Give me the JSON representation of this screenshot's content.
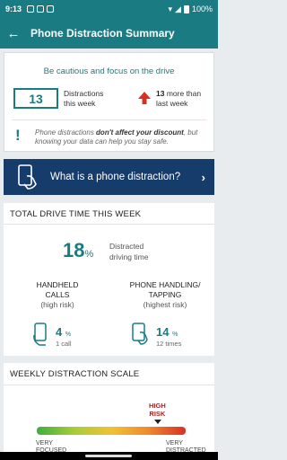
{
  "status_bar": {
    "time": "9:13",
    "battery": "100%"
  },
  "app_bar": {
    "back_icon": "arrow-left-icon",
    "title": "Phone Distraction Summary"
  },
  "summary": {
    "heading": "Be cautious and focus on the drive",
    "distractions_count": "13",
    "distractions_label_1": "Distractions",
    "distractions_label_2": "this week",
    "change_value": "13",
    "change_label_1": "more than",
    "change_label_2": "last week",
    "note_prefix": "Phone distractions ",
    "note_bold": "don't affect your discount",
    "note_suffix": ", but knowing your data can help you stay safe."
  },
  "banner": {
    "label": "What is a phone distraction?"
  },
  "drive_time": {
    "title": "TOTAL DRIVE TIME THIS WEEK",
    "distracted_pct": "18",
    "pct_sign": "%",
    "distracted_label_1": "Distracted",
    "distracted_label_2": "driving time",
    "handheld": {
      "label_1": "HANDHELD",
      "label_2": "CALLS",
      "risk": "(high risk)",
      "pct": "4",
      "pct_sign": "%",
      "sub": "1 call"
    },
    "tapping": {
      "label_1": "PHONE HANDLING/",
      "label_2": "TAPPING",
      "risk": "(highest risk)",
      "pct": "14",
      "pct_sign": "%",
      "sub": "12 times"
    }
  },
  "scale": {
    "title": "WEEKLY DISTRACTION SCALE",
    "marker_label_1": "HIGH",
    "marker_label_2": "RISK",
    "marker_level": 0.84,
    "low_label_1": "VERY",
    "low_label_2": "FOCUSED",
    "high_label_1": "VERY",
    "high_label_2": "DISTRACTED"
  },
  "colors": {
    "teal": "#1b7b83",
    "navy": "#163c6b",
    "risk_red": "#b21f1f",
    "arrow_red": "#d93025"
  }
}
